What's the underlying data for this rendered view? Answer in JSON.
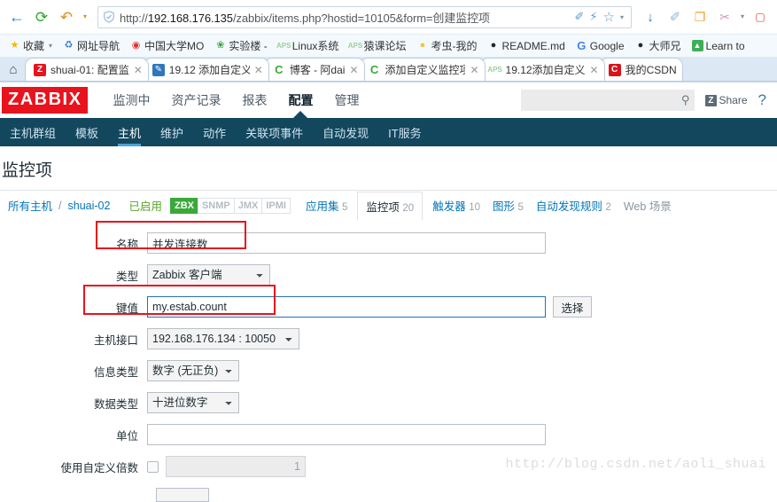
{
  "browser": {
    "toolbar_icons": [
      {
        "name": "back-icon",
        "glyph": "←",
        "color": "#2f77bd"
      },
      {
        "name": "reload-icon",
        "glyph": "⟳",
        "color": "#2ea82e"
      },
      {
        "name": "undo-history-icon",
        "glyph": "↶",
        "color": "#e08b20"
      },
      {
        "name": "history-dropdown-caret-icon",
        "glyph": "▾",
        "color": "#e08b20"
      }
    ],
    "url": {
      "scheme": "http://",
      "host": "192.168.176.135",
      "path": "/zabbix/items.php?hostid=10105&form=创建监控项",
      "full": "http://192.168.176.135/zabbix/items.php?hostid=10105&form=创建监控项",
      "security_icon": "shield-check-icon",
      "inline_icons": [
        {
          "name": "edit-pen-icon",
          "glyph": "✐"
        },
        {
          "name": "lightning-icon",
          "glyph": "⚡"
        },
        {
          "name": "bookmark-star-icon",
          "glyph": "☆"
        },
        {
          "name": "bookmark-dropdown-caret-icon",
          "glyph": "▾"
        }
      ]
    },
    "right_icons": [
      {
        "name": "download-icon",
        "glyph": "↓",
        "color": "#2f77bd"
      },
      {
        "name": "pen-tool-icon",
        "glyph": "✐",
        "color": "#7aa7d4"
      },
      {
        "name": "mobile-send-icon",
        "glyph": "❐",
        "color": "#f0a030"
      },
      {
        "name": "scissors-icon",
        "glyph": "✂",
        "color": "#d98fc0"
      },
      {
        "name": "scissors-caret-icon",
        "glyph": "▾",
        "color": "#888888"
      },
      {
        "name": "screenshot-icon",
        "glyph": "S",
        "color": "#e0443a"
      },
      {
        "name": "menu-icon",
        "glyph": "☰",
        "color": "#555555"
      }
    ],
    "bookmarks": [
      {
        "label": "收藏",
        "icon": "star-icon",
        "glyph": "★",
        "color": "#f5b700",
        "has_caret": true
      },
      {
        "label": "网址导航",
        "icon": "globe-icon",
        "glyph": "⊕",
        "color": "#3d7fc1",
        "has_caret": false
      },
      {
        "label": "中国大学MO",
        "icon": "compass-icon",
        "glyph": "◉",
        "color": "#e03030",
        "has_caret": false
      },
      {
        "label": "实验楼 -",
        "icon": "leaf-icon",
        "glyph": "❀",
        "color": "#3aa83a",
        "has_caret": false
      },
      {
        "label": "Linux系统",
        "icon": "aps-icon",
        "glyph": "A",
        "color": "#9bcf9b",
        "has_caret": false
      },
      {
        "label": "猿课论坛",
        "icon": "aps-icon",
        "glyph": "A",
        "color": "#9bcf9b",
        "has_caret": false
      },
      {
        "label": "考虫-我的",
        "icon": "chick-icon",
        "glyph": "◕",
        "color": "#f2c63c",
        "has_caret": false
      },
      {
        "label": "README.md",
        "icon": "github-icon",
        "glyph": "⬤",
        "color": "#24292e",
        "has_caret": false
      },
      {
        "label": "Google",
        "icon": "google-icon",
        "glyph": "G",
        "color": "#4285f4",
        "has_caret": false
      },
      {
        "label": "大师兄",
        "icon": "github-icon",
        "glyph": "●",
        "color": "#24292e",
        "has_caret": false
      },
      {
        "label": "Learn to",
        "icon": "learn-icon",
        "glyph": "A",
        "color": "#3fae5a",
        "has_caret": false
      }
    ],
    "home_icon": "home-icon",
    "tabs": [
      {
        "label": "shuai-01: 配置监",
        "icon": "zabbix-favicon",
        "glyph": "Z",
        "color": "#e8131d",
        "text_color": "#ffffff",
        "active": true,
        "closable": true
      },
      {
        "label": "19.12 添加自定义",
        "icon": "doc-favicon",
        "glyph": "✎",
        "color": "#2f77bd",
        "text_color": "#ffffff",
        "active": false,
        "closable": true
      },
      {
        "label": "博客 - 阿dai",
        "icon": "csdn-c-favicon",
        "glyph": "C",
        "color": "#3aa83a",
        "text_color": "#ffffff",
        "active": false,
        "closable": true
      },
      {
        "label": "添加自定义监控项",
        "icon": "csdn-c-favicon",
        "glyph": "C",
        "color": "#3aa83a",
        "text_color": "#ffffff",
        "active": false,
        "closable": true
      },
      {
        "label": "19.12添加自定义",
        "icon": "aps-favicon",
        "glyph": "A",
        "color": "#9bcf9b",
        "text_color": "#ffffff",
        "active": false,
        "closable": true
      },
      {
        "label": "我的CSDN",
        "icon": "csdn-favicon",
        "glyph": "C",
        "color": "#d9131a",
        "text_color": "#ffffff",
        "active": false,
        "closable": false
      }
    ]
  },
  "zabbix": {
    "logo": "ZABBIX",
    "brand_color": "#e8131d",
    "nav_bg_color": "#13475e",
    "top_menu": [
      {
        "label": "监测中",
        "selected": false
      },
      {
        "label": "资产记录",
        "selected": false
      },
      {
        "label": "报表",
        "selected": false
      },
      {
        "label": "配置",
        "selected": true
      },
      {
        "label": "管理",
        "selected": false
      }
    ],
    "search": {
      "value": "",
      "placeholder": "",
      "icon": "search-icon"
    },
    "share_label": "Share",
    "share_badge": "Z",
    "help_label": "?",
    "sub_menu": [
      {
        "label": "主机群组",
        "selected": false
      },
      {
        "label": "模板",
        "selected": false
      },
      {
        "label": "主机",
        "selected": true
      },
      {
        "label": "维护",
        "selected": false
      },
      {
        "label": "动作",
        "selected": false
      },
      {
        "label": "关联项事件",
        "selected": false
      },
      {
        "label": "自动发现",
        "selected": false
      },
      {
        "label": "IT服务",
        "selected": false
      }
    ],
    "page_title": "监控项",
    "breadcrumb": {
      "all_hosts": "所有主机",
      "separator": "/",
      "host": "shuai-02",
      "status": "已启用",
      "protocols": [
        {
          "label": "ZBX",
          "active": true
        },
        {
          "label": "SNMP",
          "active": false
        },
        {
          "label": "JMX",
          "active": false
        },
        {
          "label": "IPMI",
          "active": false
        }
      ],
      "tabs": [
        {
          "label": "应用集",
          "count": "5",
          "current": false
        },
        {
          "label": "监控项",
          "count": "20",
          "current": true
        },
        {
          "label": "触发器",
          "count": "10",
          "current": false
        },
        {
          "label": "图形",
          "count": "5",
          "current": false
        },
        {
          "label": "自动发现规则",
          "count": "2",
          "current": false
        },
        {
          "label": "Web 场景",
          "count": "",
          "current": false
        }
      ]
    },
    "form": {
      "name": {
        "label": "名称",
        "value": "并发连接数",
        "highlighted": true
      },
      "type": {
        "label": "类型",
        "value": "Zabbix 客户端"
      },
      "key": {
        "label": "键值",
        "value": "my.estab.count",
        "button": "选择",
        "highlighted": true
      },
      "interface": {
        "label": "主机接口",
        "value": "192.168.176.134 : 10050"
      },
      "info_type": {
        "label": "信息类型",
        "value": "数字 (无正负)"
      },
      "data_type": {
        "label": "数据类型",
        "value": "十进位数字"
      },
      "unit": {
        "label": "单位",
        "value": ""
      },
      "multiplier": {
        "label": "使用自定义倍数",
        "value": "1",
        "checked": false
      }
    },
    "highlight_color": "#e8131d"
  },
  "watermark": "http://blog.csdn.net/aoli_shuai"
}
